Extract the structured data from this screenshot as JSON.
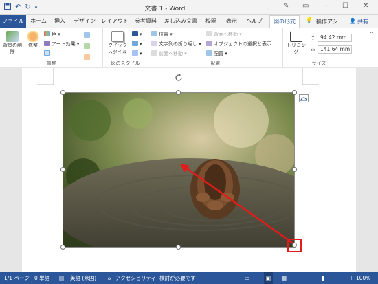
{
  "titlebar": {
    "title": "文書 1 - Word",
    "save_icon": "save-icon",
    "undo_icon": "undo-icon",
    "redo_icon": "redo-icon"
  },
  "tabs": [
    {
      "label": "ファイル"
    },
    {
      "label": "ホーム"
    },
    {
      "label": "挿入"
    },
    {
      "label": "デザイン"
    },
    {
      "label": "レイアウト"
    },
    {
      "label": "参考資料"
    },
    {
      "label": "差し込み文書"
    },
    {
      "label": "校閲"
    },
    {
      "label": "表示"
    },
    {
      "label": "ヘルプ"
    },
    {
      "label": "図の形式"
    }
  ],
  "tell_me": "操作アシ",
  "share": "共有",
  "ribbon": {
    "adjust": {
      "remove_bg": "背景の削除",
      "corrections": "修整",
      "color": "色",
      "artistic": "アート効果",
      "group_label": "調整"
    },
    "styles": {
      "quick_styles": "クイック スタイル",
      "group_label": "図のスタイル"
    },
    "arrange": {
      "position": "位置",
      "wrap_text": "文字列の折り返し",
      "bring_forward": "前面へ移動",
      "send_backward": "背面へ移動",
      "selection_pane": "オブジェクトの選択と表示",
      "align": "配置",
      "group_label": "配置"
    },
    "size": {
      "crop": "トリミング",
      "height": "94.42 mm",
      "width": "141.64 mm",
      "group_label": "サイズ"
    }
  },
  "statusbar": {
    "page": "1/1 ページ",
    "words": "0 単語",
    "language": "英語 (米国)",
    "accessibility": "アクセシビリティ: 検討が必要です",
    "zoom": "100%"
  },
  "colors": {
    "accent": "#2b579a",
    "highlight": "#e21b1b"
  }
}
